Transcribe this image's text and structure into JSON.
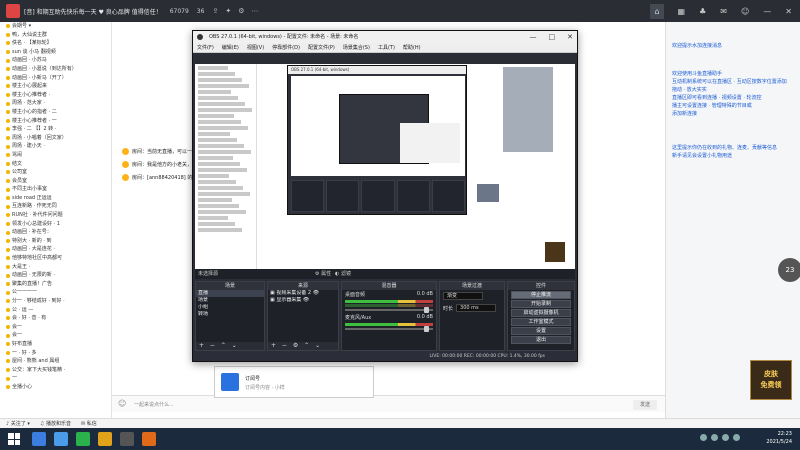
{
  "topbar": {
    "title": "[音] 和期互助先快乐每一天 ♥ 良心品牌 值得信任！",
    "viewers": "67079",
    "fans": "36",
    "icons": [
      "share-icon",
      "gift-icon",
      "settings-icon"
    ]
  },
  "left_list": {
    "items": [
      "会期号 ▾",
      "鸭，大仙说主群",
      "佚名 · 【某标轮】",
      "sun 谈 小马 翻视频",
      "动画回 · 小苏马",
      "动画回 · 小葛说（到达所有）",
      "动画回 · 小新马（开了）",
      "楼主小心展起来",
      "楼主小心推荐者 ·",
      "周扬 · 范大家 ·",
      "楼主小心的指者 · 二",
      "楼主小心推荐者 · 一",
      "李强 · 二 【】2 转 ·",
      "周扬 · 小唱着（回文家）",
      "周扬 · 建小天 ·",
      "骂闹",
      "结文",
      "公司室",
      "会员室",
      "不同主出小事室",
      "side road 正运运",
      "互连新路 · 作死无同",
      "RUN社 · 补代件问问题",
      "领发小心总建设好 · 1",
      "动画回 · 补在号：",
      "特别大 · 新的 · 到",
      "动画回 · 大是连花 ·",
      "他够特地社区中高都可",
      "大是王 ·",
      "动画回 · 无限的新 ·",
      "聚集的直播！广告",
      "公一一一一",
      "分一 · 够结成好 · 到好 ·",
      "公 · 运 —",
      "会 · 好 · 音 · 有",
      "会一",
      "会一",
      "好布直播",
      "一 · 好 · 多",
      "屋间 · 熊熊 and 属组",
      "公交：家下大买钱笔精 ·",
      "一",
      "全播小心"
    ]
  },
  "center": {
    "messages": [
      "房间：当前无直播，可以一起讨论 · 会会",
      "房间：我是他方的小老关，没开一看看过",
      "房间：[ann88420418] 的权限发给他位置"
    ],
    "input_placeholder": "一起来说点什么...",
    "send_label": "发送",
    "card_title": "订阅号",
    "card_sub": "订阅号内容 · 小样"
  },
  "right_panel": {
    "tip1": "欢迎提示水加连接消息",
    "tip2": "欢迎使用斗鱼直播助手\n互动机制系统可以在直播区 · 互动区按数字位置添加\n拖动 · 放大实实\n直播区即可看到连播 · 视频设置 · 轮流控\n播主可设置连接 · 管理特殊的节目或\n添加新连接",
    "tip3": "这里提示你仍在收到的礼物、连麦、贡献等信息\n新手请见会设置小礼物用途",
    "count": "23",
    "ad_line1": "皮肤",
    "ad_line2": "免费领"
  },
  "obs": {
    "title": "OBS 27.0.1 (64-bit, windows) - 配置文件: 未命名 - 场景: 未命名",
    "menu": [
      "文件(F)",
      "编辑(E)",
      "视图(V)",
      "停靠部件(D)",
      "配置文件(P)",
      "场景集合(S)",
      "工具(T)",
      "帮助(H)"
    ],
    "source_bar": "未选择源",
    "props": "属性",
    "filters": "滤镜",
    "scenes_header": "场景",
    "scenes": [
      "直播",
      "场景",
      "小组",
      "转场"
    ],
    "sources_header": "来源",
    "sources": [
      "视频采集设备 2",
      "显示器采集"
    ],
    "mixer_header": "混音器",
    "mixer_ch1": "桌面音频",
    "mixer_ch1_db": "0.0 dB",
    "mixer_ch2": "麦克风/Aux",
    "mixer_ch2_db": "0.0 dB",
    "transitions_header": "场景过渡",
    "transition_type": "渐变",
    "duration_label": "时长",
    "duration_value": "300 ms",
    "controls_header": "控件",
    "controls": [
      "停止推流",
      "开始录制",
      "启动虚拟摄像机",
      "工作室模式",
      "设置",
      "退出"
    ],
    "status": "LIVE: 00:00:00   REC: 00:00:00   CPU: 1.4%, 30.00 fps",
    "nested_title": "OBS 27.0.1 (64-bit, windows)"
  },
  "strip": {
    "items": [
      "♪ 关注了 ▾",
      "♫ 播放和乐音",
      "✉ 私信"
    ]
  },
  "taskbar": {
    "time": "22:23",
    "date": "2021/5/24"
  }
}
